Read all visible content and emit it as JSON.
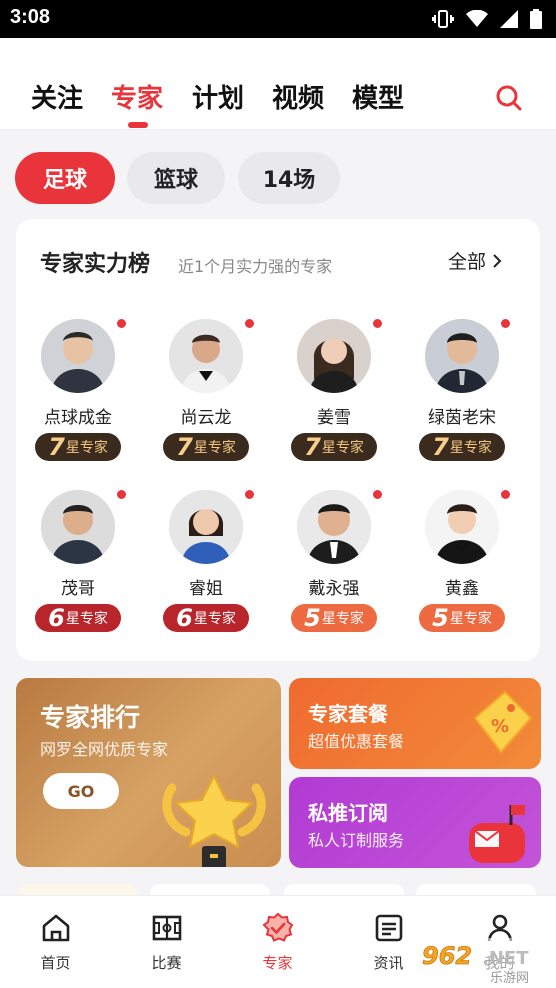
{
  "status_bar": {
    "time": "3:08"
  },
  "top_nav": {
    "tabs": [
      {
        "label": "关注",
        "active": false
      },
      {
        "label": "专家",
        "active": true
      },
      {
        "label": "计划",
        "active": false
      },
      {
        "label": "视频",
        "active": false
      },
      {
        "label": "模型",
        "active": false
      }
    ],
    "search_icon": "search-icon"
  },
  "filter_chips": [
    {
      "label": "足球",
      "active": true
    },
    {
      "label": "篮球",
      "active": false
    },
    {
      "label": "14场",
      "active": false
    }
  ],
  "ranking": {
    "title": "专家实力榜",
    "subtitle": "近1个月实力强的专家",
    "all_label": "全部",
    "experts": [
      {
        "name": "点球成金",
        "stars": "7",
        "badge_text": "星专家",
        "tier": "b7"
      },
      {
        "name": "尚云龙",
        "stars": "7",
        "badge_text": "星专家",
        "tier": "b7"
      },
      {
        "name": "姜雪",
        "stars": "7",
        "badge_text": "星专家",
        "tier": "b7"
      },
      {
        "name": "绿茵老宋",
        "stars": "7",
        "badge_text": "星专家",
        "tier": "b7"
      },
      {
        "name": "茂哥",
        "stars": "6",
        "badge_text": "星专家",
        "tier": "b6"
      },
      {
        "name": "睿姐",
        "stars": "6",
        "badge_text": "星专家",
        "tier": "b6"
      },
      {
        "name": "戴永强",
        "stars": "5",
        "badge_text": "星专家",
        "tier": "b5"
      },
      {
        "name": "黄鑫",
        "stars": "5",
        "badge_text": "星专家",
        "tier": "b5"
      }
    ]
  },
  "promos": {
    "big": {
      "title": "专家排行",
      "subtitle": "网罗全网优质专家",
      "button": "GO"
    },
    "package": {
      "title": "专家套餐",
      "subtitle": "超值优惠套餐"
    },
    "private": {
      "title": "私推订阅",
      "subtitle": "私人订制服务"
    }
  },
  "bottom_nav": [
    {
      "label": "首页",
      "icon": "home-icon",
      "active": false
    },
    {
      "label": "比赛",
      "icon": "pitch-icon",
      "active": false
    },
    {
      "label": "专家",
      "icon": "expert-badge-icon",
      "active": true
    },
    {
      "label": "资讯",
      "icon": "news-icon",
      "active": false
    },
    {
      "label": "我的",
      "icon": "profile-icon",
      "active": false
    }
  ],
  "watermark": {
    "logo_text": "962.NET",
    "sub_text": "乐游网"
  },
  "colors": {
    "accent": "#e8343a",
    "orange": "#ef6a2f",
    "purple": "#b13bd3",
    "gold": "#c98d4f"
  }
}
